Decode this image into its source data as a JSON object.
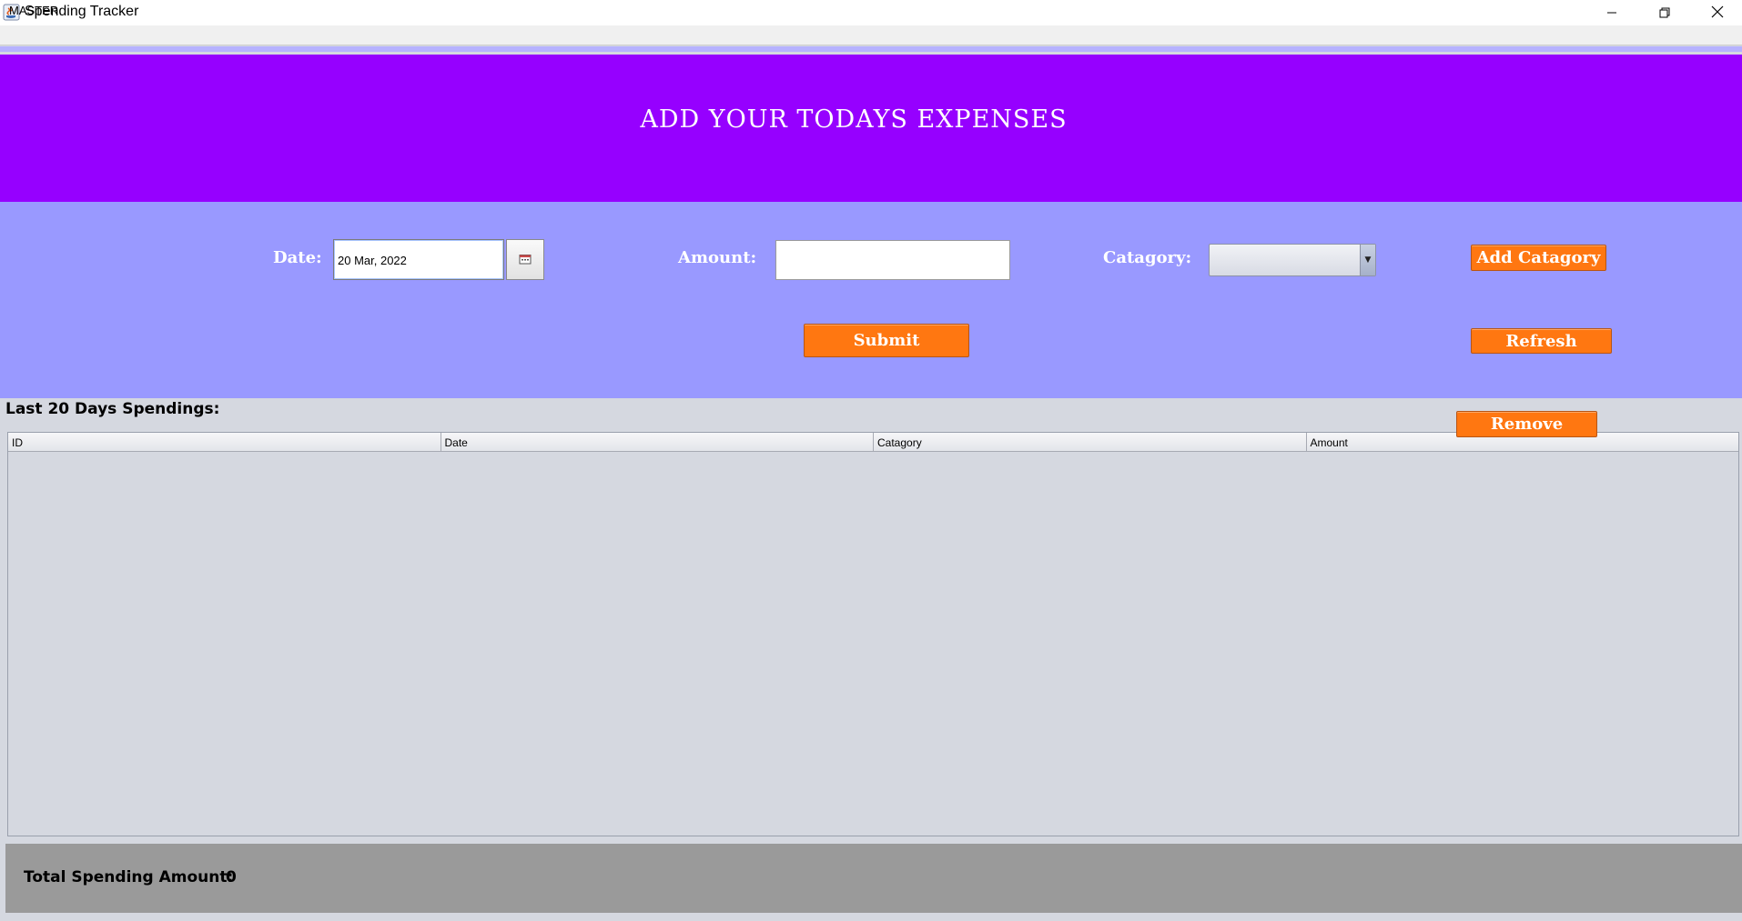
{
  "window": {
    "title": "Spending Tracker",
    "controls": {
      "minimize_icon": "minimize-icon",
      "maximize_icon": "restore-icon",
      "close_icon": "close-icon"
    }
  },
  "menu": {
    "items": [
      "MASTER"
    ]
  },
  "header": {
    "title": "ADD YOUR TODAYS EXPENSES"
  },
  "form": {
    "date_label": "Date:",
    "date_value": "20 Mar, 2022",
    "amount_label": "Amount:",
    "amount_value": "",
    "category_label": "Catagory:",
    "category_selected": "",
    "add_category_label": "Add Catagory",
    "submit_label": "Submit",
    "refresh_label": "Refresh"
  },
  "table": {
    "caption": "Last 20 Days Spendings:",
    "remove_label": "Remove",
    "columns": [
      "ID",
      "Date",
      "Catagory",
      "Amount"
    ],
    "rows": []
  },
  "footer": {
    "total_label": "Total Spending Amount:",
    "total_value": "0"
  },
  "colors": {
    "header_bg": "#9600ff",
    "form_bg": "#9999ff",
    "button_bg": "#ff7711",
    "footer_bg": "#9a9a9a",
    "table_bg": "#d5d8e0"
  }
}
